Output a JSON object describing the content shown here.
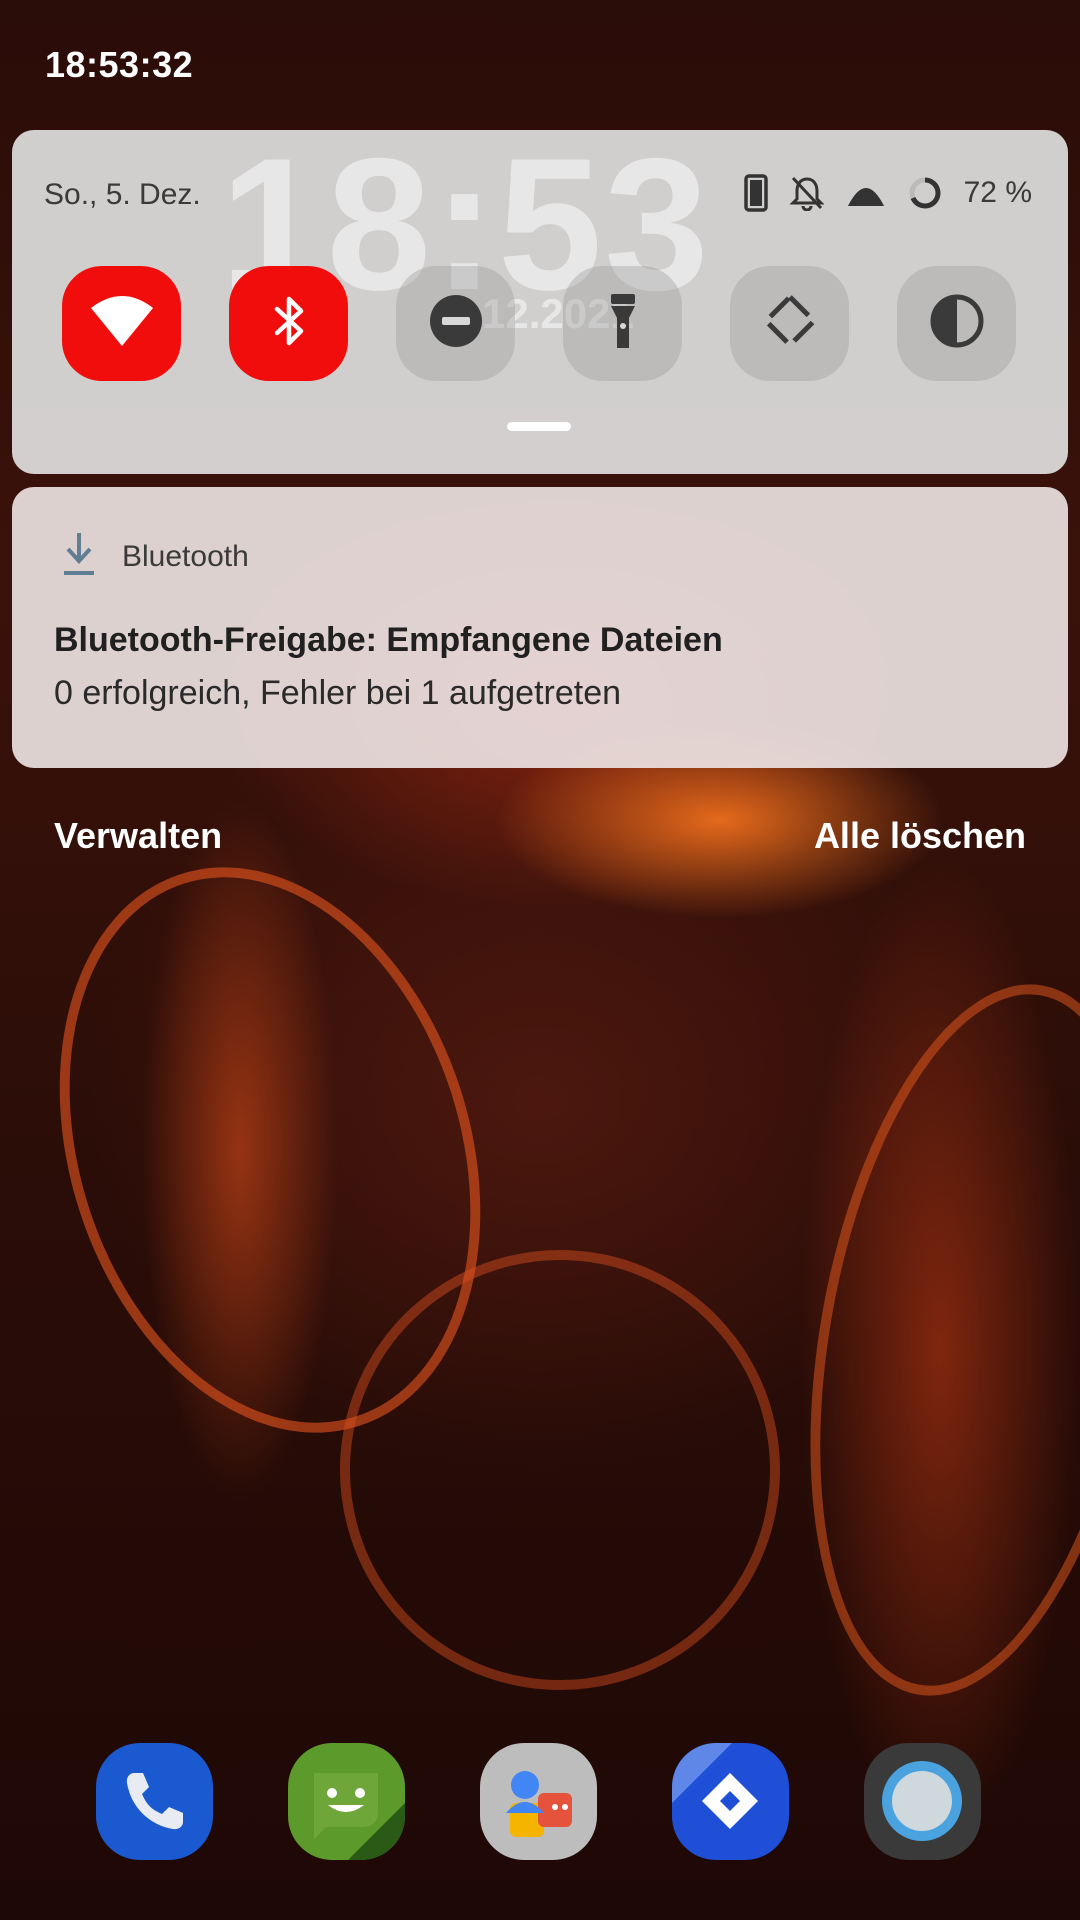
{
  "status_bar": {
    "time": "18:53:32"
  },
  "quick_settings": {
    "background_clock": "18:53",
    "background_date": "12.2021",
    "date": "So., 5. Dez.",
    "battery_percent": "72 %",
    "status_icons": [
      "phone-icon",
      "bell-off-icon",
      "signal-icon",
      "battery-ring-icon"
    ],
    "tiles": [
      {
        "name": "wifi",
        "icon": "wifi-icon",
        "active": true
      },
      {
        "name": "bluetooth",
        "icon": "bluetooth-icon",
        "active": true
      },
      {
        "name": "do-not-disturb",
        "icon": "dnd-icon",
        "active": false
      },
      {
        "name": "flashlight",
        "icon": "flashlight-icon",
        "active": false
      },
      {
        "name": "auto-rotate",
        "icon": "rotate-icon",
        "active": false
      },
      {
        "name": "dark-theme",
        "icon": "contrast-icon",
        "active": false
      }
    ],
    "accent_color": "#f20d0d"
  },
  "notification": {
    "app_name": "Bluetooth",
    "icon": "download-icon",
    "title": "Bluetooth-Freigabe: Empfangene Dateien",
    "text": "0 erfolgreich, Fehler bei 1 aufgetreten"
  },
  "actions": {
    "manage": "Verwalten",
    "clear_all": "Alle löschen"
  },
  "dock": [
    "phone-app",
    "messages-app",
    "contacts-app",
    "maps-app",
    "camera-app"
  ]
}
